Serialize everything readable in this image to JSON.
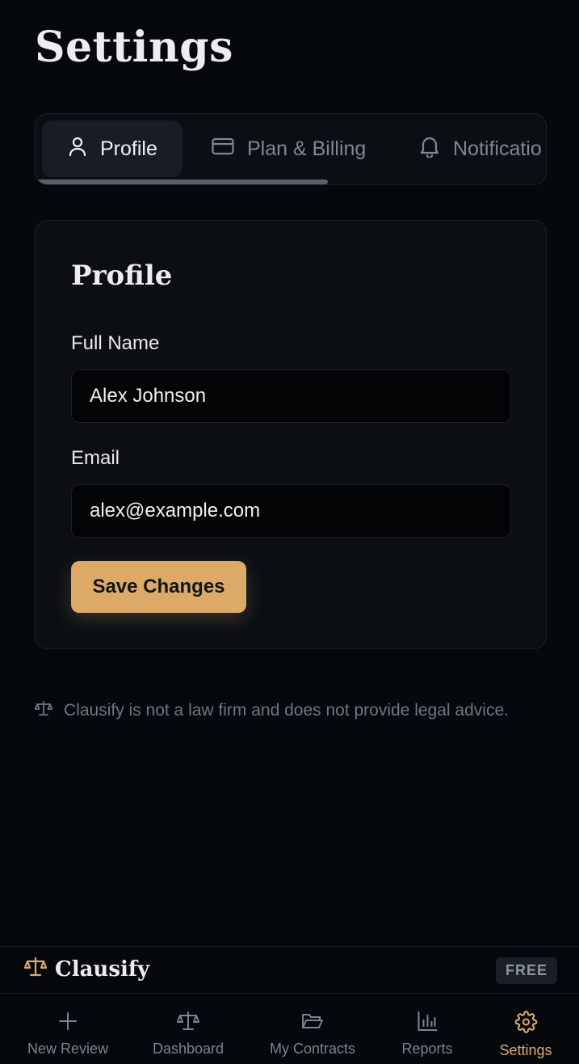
{
  "page": {
    "title": "Settings"
  },
  "tabs": [
    {
      "label": "Profile",
      "icon": "user-icon",
      "active": true
    },
    {
      "label": "Plan & Billing",
      "icon": "credit-card-icon",
      "active": false
    },
    {
      "label": "Notificatio",
      "icon": "bell-icon",
      "active": false
    }
  ],
  "profile": {
    "title": "Profile",
    "full_name_label": "Full Name",
    "full_name_value": "Alex Johnson",
    "email_label": "Email",
    "email_value": "alex@example.com",
    "save_label": "Save Changes"
  },
  "disclaimer": {
    "icon": "scale-icon",
    "text": "Clausify is not a law firm and does not provide legal advice."
  },
  "brand": {
    "name": "Clausify",
    "icon": "scale-icon",
    "plan_badge": "FREE"
  },
  "nav": {
    "items": [
      {
        "label": "New Review",
        "icon": "plus-icon",
        "active": false
      },
      {
        "label": "Dashboard",
        "icon": "scale-icon",
        "active": false
      },
      {
        "label": "My Contracts",
        "icon": "folder-open-icon",
        "active": false
      },
      {
        "label": "Reports",
        "icon": "bar-chart-icon",
        "active": false
      },
      {
        "label": "Settings",
        "icon": "gear-icon",
        "active": true
      }
    ]
  },
  "colors": {
    "background": "#05080c",
    "card": "#0b0f14",
    "accent": "#dcaa66",
    "muted_text": "#7a8490"
  }
}
